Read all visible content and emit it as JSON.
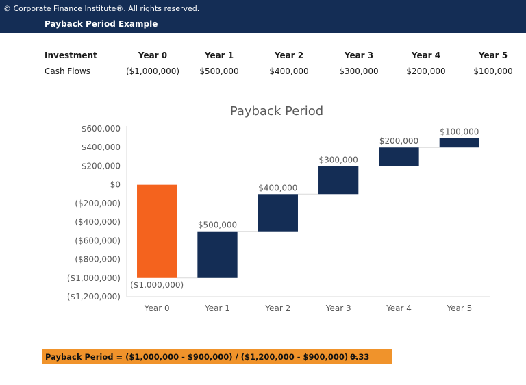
{
  "header": {
    "copyright": "© Corporate Finance Institute®. All rights reserved.",
    "title": "Payback Period Example",
    "background": "#142d55"
  },
  "cash_flow_table": {
    "row_header_label": "Investment",
    "row_values_label": "Cash Flows",
    "columns": [
      "Year 0",
      "Year 1",
      "Year 2",
      "Year 3",
      "Year 4",
      "Year 5"
    ],
    "values": [
      "($1,000,000)",
      "$500,000",
      "$400,000",
      "$300,000",
      "$200,000",
      "$100,000"
    ]
  },
  "chart_data": {
    "type": "bar",
    "subtype": "waterfall",
    "title": "Payback Period",
    "categories": [
      "Year 0",
      "Year 1",
      "Year 2",
      "Year 3",
      "Year 4",
      "Year 5"
    ],
    "values": [
      -1000000,
      500000,
      400000,
      300000,
      200000,
      100000
    ],
    "cumulative_start": [
      0,
      -1000000,
      -500000,
      -100000,
      200000,
      400000
    ],
    "cumulative_end": [
      -1000000,
      -500000,
      -100000,
      200000,
      400000,
      500000
    ],
    "data_labels": [
      "($1,000,000)",
      "$500,000",
      "$400,000",
      "$300,000",
      "$200,000",
      "$100,000"
    ],
    "yticks": [
      600000,
      400000,
      200000,
      0,
      -200000,
      -400000,
      -600000,
      -800000,
      -1000000,
      -1200000
    ],
    "ytick_labels": [
      "$600,000",
      "$400,000",
      "$200,000",
      "$0",
      "($200,000)",
      "($400,000)",
      "($600,000)",
      "($800,000)",
      "($1,000,000)",
      "($1,200,000)"
    ],
    "ylim": [
      -1200000,
      600000
    ],
    "xlabel": "",
    "ylabel": "",
    "grid": false,
    "legend": "none",
    "colors": {
      "negative": "#f4631e",
      "positive": "#142d55",
      "connector": "#d9d9d9",
      "axis": "#d9d9d9",
      "text": "#595959"
    }
  },
  "result": {
    "formula": "Payback Period = ($1,000,000 - $900,000) / ($1,200,000 - $900,000) =",
    "value": "0.33",
    "background": "#f0932b"
  }
}
